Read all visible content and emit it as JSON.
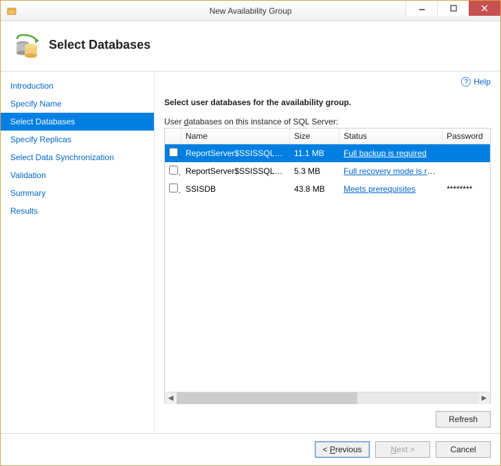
{
  "window": {
    "title": "New Availability Group"
  },
  "header": {
    "title": "Select Databases"
  },
  "help": {
    "label": "Help"
  },
  "sidebar": {
    "items": [
      {
        "label": "Introduction"
      },
      {
        "label": "Specify Name"
      },
      {
        "label": "Select Databases"
      },
      {
        "label": "Specify Replicas"
      },
      {
        "label": "Select Data Synchronization"
      },
      {
        "label": "Validation"
      },
      {
        "label": "Summary"
      },
      {
        "label": "Results"
      }
    ],
    "selected_index": 2
  },
  "main": {
    "instruction": "Select user databases for the availability group.",
    "list_label_prefix": "User ",
    "list_label_underlined": "d",
    "list_label_rest": "atabases on this instance of SQL Server:",
    "columns": {
      "name": "Name",
      "size": "Size",
      "status": "Status",
      "password": "Password"
    },
    "rows": [
      {
        "name": "ReportServer$SSISSQLSER...",
        "size": "11.1 MB",
        "status": "Full backup is required",
        "password": "",
        "selected": true
      },
      {
        "name": "ReportServer$SSISSQLSER...",
        "size": "5.3 MB",
        "status": "Full recovery mode is re...",
        "password": "",
        "selected": false
      },
      {
        "name": "SSISDB",
        "size": "43.8 MB",
        "status": "Meets prerequisites",
        "password": "********",
        "selected": false
      }
    ],
    "refresh_label": "Refresh"
  },
  "footer": {
    "previous": "revious",
    "previous_prefix": "< ",
    "previous_u": "P",
    "next_u": "N",
    "next_rest": "ext >",
    "cancel": "Cancel"
  }
}
